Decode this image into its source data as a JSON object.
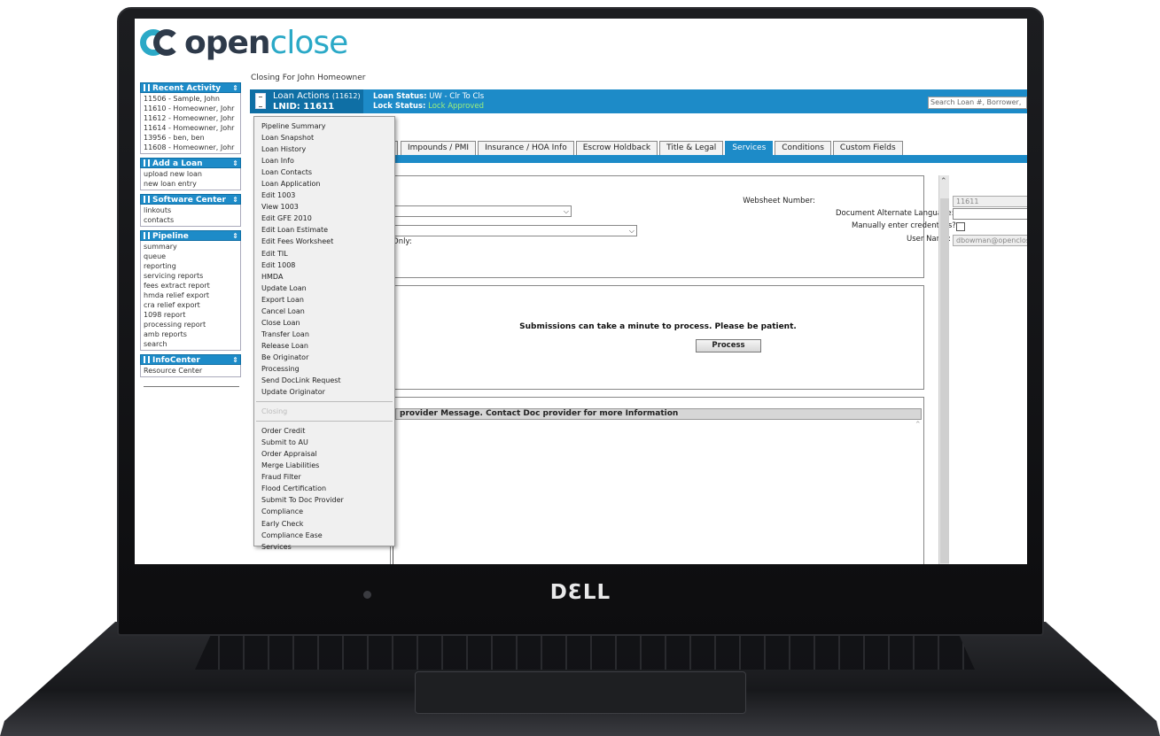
{
  "app": {
    "logo_text_bold": "open",
    "logo_text_light": "close",
    "closing_for": "Closing For John Homeowner"
  },
  "sidebar": {
    "recent_activity": {
      "title": "Recent Activity",
      "items": [
        "11506 - Sample, John",
        "11610 - Homeowner, Johr",
        "11612 - Homeowner, Johr",
        "11614 - Homeowner, Johr",
        "13956 - ben, ben",
        "11608 - Homeowner, Johr"
      ]
    },
    "add_loan": {
      "title": "Add a Loan",
      "items": [
        "upload new loan",
        "new loan entry"
      ]
    },
    "software_center": {
      "title": "Software Center",
      "items": [
        "linkouts",
        "contacts"
      ]
    },
    "pipeline": {
      "title": "Pipeline",
      "items": [
        "summary",
        "queue",
        "reporting",
        "servicing reports",
        "fees extract report",
        "hmda relief export",
        "cra relief export",
        "1098 report",
        "processing report",
        "amb reports",
        "search"
      ]
    },
    "infocenter": {
      "title": "InfoCenter",
      "items": [
        "Resource Center"
      ]
    }
  },
  "statusbar": {
    "loan_actions": "Loan Actions",
    "loan_actions_count": "(11612)",
    "lnid": "LNID: 11611",
    "loan_status_label": "Loan Status:",
    "loan_status_value": "UW - Clr To Cls",
    "lock_status_label": "Lock Status:",
    "lock_status_value": "Lock Approved",
    "search_placeholder": "Search Loan #, Borrower,"
  },
  "tabs": [
    "Impounds / PMI",
    "Insurance / HOA Info",
    "Escrow Holdback",
    "Title & Legal",
    "Services",
    "Conditions",
    "Custom Fields"
  ],
  "active_tab": "Services",
  "form": {
    "websheet_label": "Websheet Number:",
    "websheet_value": "11611",
    "alt_language_label": "Document Alternate Language:",
    "manual_credentials_label": "Manually enter credentials?",
    "username_label": "User Name:",
    "username_value": "dbowman@openclose.com",
    "only_label": "Only:",
    "submission_note": "Submissions can take a minute to process. Please be patient.",
    "process_button": "Process",
    "provider_message": "provider Message. Contact Doc provider for more Information"
  },
  "loan_menu": {
    "items": [
      "Pipeline Summary",
      "Loan Snapshot",
      "Loan History",
      "Loan Info",
      "Loan Contacts",
      "Loan Application",
      "Edit 1003",
      "View 1003",
      "Edit GFE 2010",
      "Edit Loan Estimate",
      "Edit Fees Worksheet",
      "Edit TIL",
      "Edit 1008",
      "HMDA",
      "Update Loan",
      "Export Loan",
      "Cancel Loan",
      "Close Loan",
      "Transfer Loan",
      "Release Loan",
      "Be Originator",
      "Processing",
      "Send DocLink Request",
      "Update Originator"
    ],
    "section_label": "Closing",
    "closing_items": [
      "Order Credit",
      "Submit to AU",
      "Order Appraisal",
      "Merge Liabilities",
      "Fraud Filter",
      "Flood Certification",
      "Submit To Doc Provider",
      "Compliance",
      "Early Check",
      "Compliance Ease",
      "Services"
    ]
  },
  "device": {
    "brand": "DƐLL"
  },
  "colors": {
    "accent": "#1d8bc8",
    "accent_dark": "#0f6fa5",
    "lock_green": "#9ef07a"
  }
}
